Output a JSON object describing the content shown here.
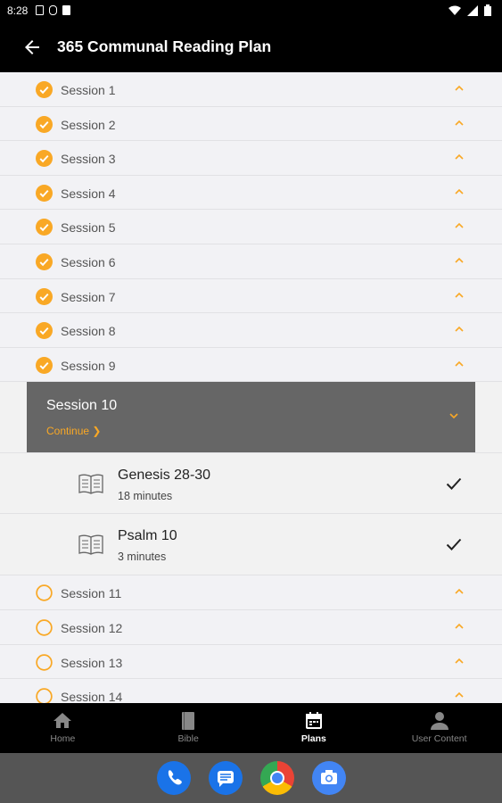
{
  "status_bar": {
    "time": "8:28"
  },
  "app_bar": {
    "title": "365 Communal Reading Plan"
  },
  "sessions_before": [
    {
      "label": "Session 1"
    },
    {
      "label": "Session 2"
    },
    {
      "label": "Session 3"
    },
    {
      "label": "Session 4"
    },
    {
      "label": "Session 5"
    },
    {
      "label": "Session 6"
    },
    {
      "label": "Session 7"
    },
    {
      "label": "Session 8"
    },
    {
      "label": "Session 9"
    }
  ],
  "expanded_session": {
    "title": "Session 10",
    "continue_label": "Continue ❯",
    "readings": [
      {
        "title": "Genesis 28-30",
        "duration": "18 minutes"
      },
      {
        "title": "Psalm 10",
        "duration": "3 minutes"
      }
    ]
  },
  "sessions_after": [
    {
      "label": "Session 11"
    },
    {
      "label": "Session 12"
    },
    {
      "label": "Session 13"
    },
    {
      "label": "Session 14"
    }
  ],
  "bottom_nav": [
    {
      "label": "Home",
      "icon": "home-icon"
    },
    {
      "label": "Bible",
      "icon": "bible-icon"
    },
    {
      "label": "Plans",
      "icon": "calendar-icon"
    },
    {
      "label": "User Content",
      "icon": "person-icon"
    }
  ],
  "colors": {
    "accent": "#f9a825",
    "app_bar": "#000000",
    "list_bg": "#f2f2f5",
    "expanded_bg": "#666666"
  }
}
